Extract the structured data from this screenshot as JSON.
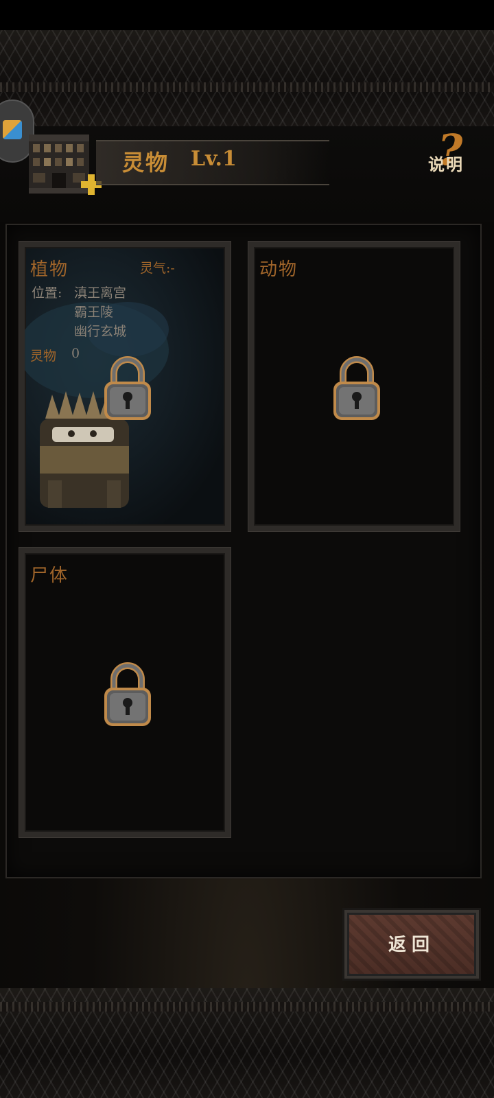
{
  "header": {
    "title": "灵物",
    "level": "Lv.1",
    "help_label": "说明",
    "help_mark": "?"
  },
  "cards": {
    "plant": {
      "title": "植物",
      "aura": "灵气:-",
      "location_label": "位置:",
      "locations": [
        "滇王离宫",
        "霸王陵",
        "幽行玄城"
      ],
      "count_label": "灵物",
      "count": "0",
      "locked": true
    },
    "animal": {
      "title": "动物",
      "locked": true
    },
    "corpse": {
      "title": "尸体",
      "locked": true
    }
  },
  "footer": {
    "back_label": "返回"
  },
  "colors": {
    "accent_gold": "#c88d36",
    "card_title": "#a0652a",
    "back_button": "#5d3a30"
  },
  "icons": {
    "building": "building-icon",
    "plus": "plus-icon",
    "lock": "lock-icon",
    "help": "question-mark-icon"
  }
}
